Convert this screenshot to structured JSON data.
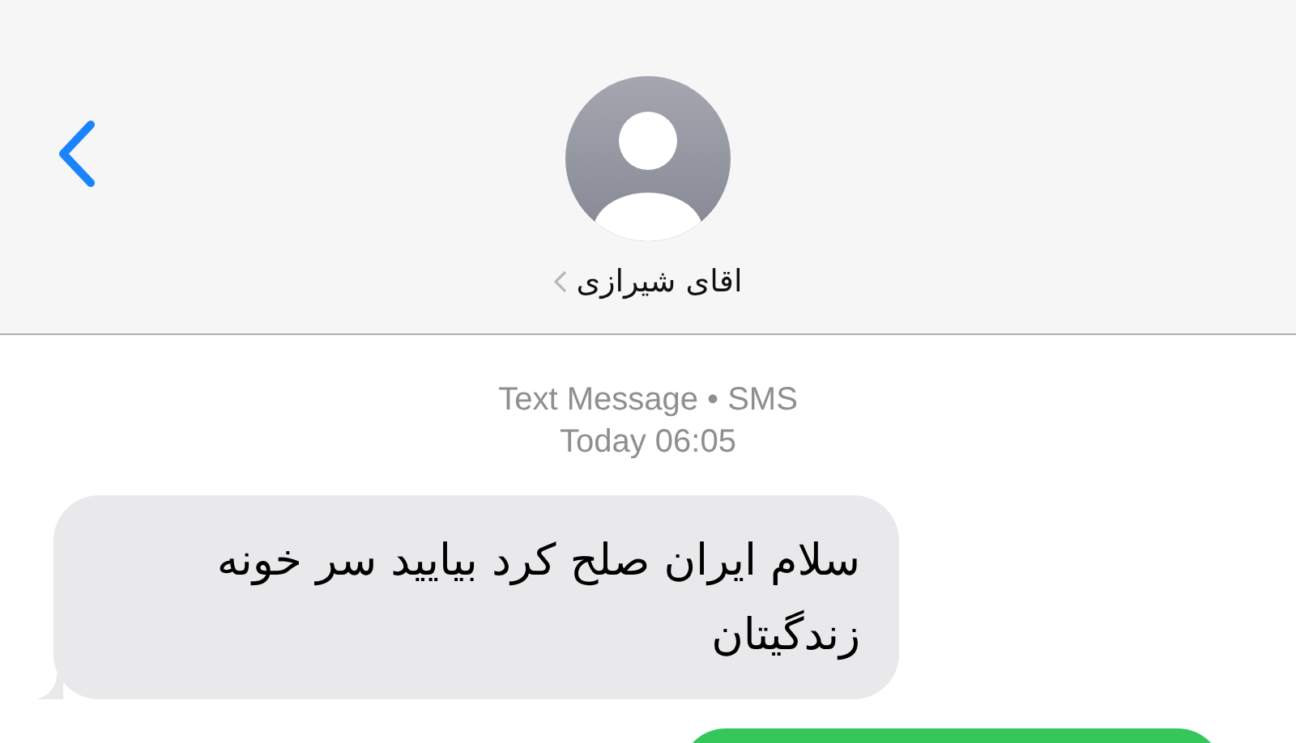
{
  "header": {
    "contact_name": "اقای شیرازی"
  },
  "meta": {
    "service": "Text Message • SMS",
    "time": "Today 06:05"
  },
  "messages": [
    {
      "kind": "received",
      "text": "سلام ایران صلح کرد بیایید سر خونه زندگیتان"
    },
    {
      "kind": "sent"
    }
  ]
}
